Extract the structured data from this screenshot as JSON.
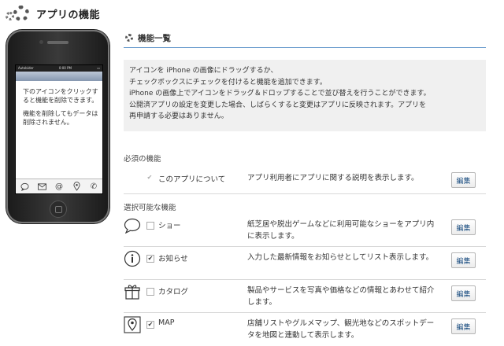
{
  "header": {
    "title": "アプリの機能",
    "icon": "gear-icon"
  },
  "phone": {
    "status_carrier": "Autobider",
    "status_time": "0:00 PM",
    "message_lines": [
      "下のアイコンをクリックすると機能を削除できます。",
      "機能を削除してもデータは削除されません。"
    ],
    "tab_icons": [
      "chat-icon",
      "mail-icon",
      "at-icon",
      "map-pin-icon",
      "phone-icon"
    ]
  },
  "section": {
    "title": "機能一覧"
  },
  "info": {
    "lines": [
      "アイコンを iPhone の画像にドラッグするか、",
      "チェックボックスにチェックを付けると機能を追加できます。",
      "iPhone の画像上でアイコンをドラッグ＆ドロップすることで並び替えを行うことができます。",
      "公開済アプリの設定を変更した場合、しばらくすると変更はアプリに反映されます。アプリを",
      "再申請する必要はありません。"
    ]
  },
  "required": {
    "label": "必須の機能",
    "items": [
      {
        "name": "このアプリについて",
        "description": "アプリ利用者にアプリに関する説明を表示します。",
        "checked": true,
        "edit_label": "編集"
      }
    ]
  },
  "optional": {
    "label": "選択可能な機能",
    "items": [
      {
        "icon": "speech-bubble-icon",
        "name": "ショー",
        "checked": false,
        "description": "紙芝居や脱出ゲームなどに利用可能なショーをアプリ内に表示します。",
        "edit_label": "編集"
      },
      {
        "icon": "info-icon",
        "name": "お知らせ",
        "checked": true,
        "description": "入力した最新情報をお知らせとしてリスト表示します。",
        "edit_label": "編集"
      },
      {
        "icon": "gift-icon",
        "name": "カタログ",
        "checked": false,
        "description": "製品やサービスを写真や価格などの情報とあわせて紹介します。",
        "edit_label": "編集"
      },
      {
        "icon": "map-pin-icon",
        "name": "MAP",
        "checked": true,
        "description": "店舗リストやグルメマップ、観光地などのスポットデータを地図と連動して表示します。",
        "edit_label": "編集"
      }
    ]
  },
  "colors": {
    "accent": "#6699cc",
    "link": "#1a4d80",
    "info_bg": "#f0f0f0"
  }
}
